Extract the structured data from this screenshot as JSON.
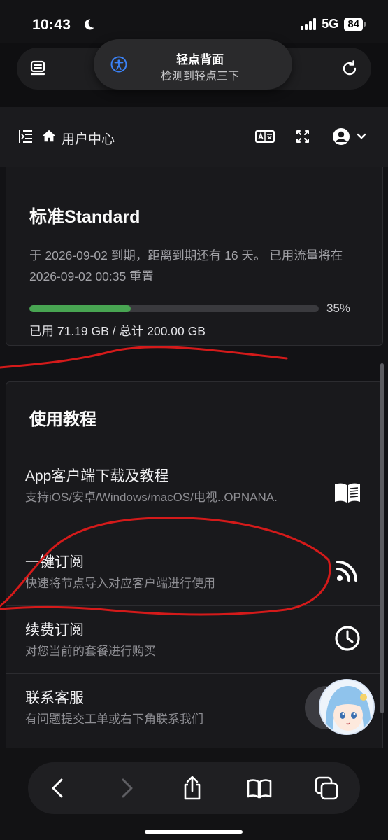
{
  "status_bar": {
    "time": "10:43",
    "network": "5G",
    "battery": "84"
  },
  "safari_top": {
    "accessibility_toast": {
      "title": "轻点背面",
      "subtitle": "检测到轻点三下"
    }
  },
  "header": {
    "title": "用户中心"
  },
  "subscription": {
    "plan_name": "标准Standard",
    "expiry_text": "于 2026-09-02 到期，距离到期还有 16 天。 已用流量将在 2026-09-02 00:35 重置",
    "progress_percent": 35,
    "progress_label": "35%",
    "usage_text": "已用 71.19 GB / 总计 200.00 GB"
  },
  "tutorial": {
    "heading": "使用教程",
    "items": [
      {
        "title": "App客户端下载及教程",
        "desc": "支持iOS/安卓/Windows/macOS/电视..OPNANA.",
        "icon": "book-icon"
      },
      {
        "title": "一键订阅",
        "desc": "快速将节点导入对应客户端进行使用",
        "icon": "rss-icon"
      },
      {
        "title": "续费订阅",
        "desc": "对您当前的套餐进行购买",
        "icon": "clock-icon"
      },
      {
        "title": "联系客服",
        "desc": "有问题提交工单或右下角联系我们",
        "icon": "support-icon"
      }
    ]
  },
  "colors": {
    "progress_fill": "#48a552",
    "annotation_red": "#d41a1a"
  }
}
